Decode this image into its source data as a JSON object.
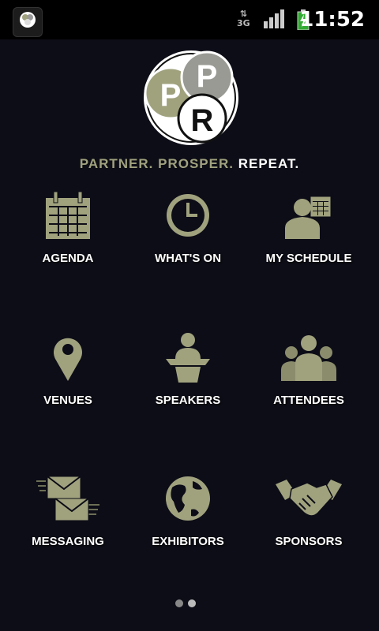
{
  "status": {
    "time": "11:52",
    "network": "3G",
    "app_icon": "ppr-app-icon",
    "icons": [
      "data-arrows-icon",
      "signal-icon",
      "battery-charging-icon"
    ]
  },
  "brand": {
    "logo_letters": [
      "P",
      "P",
      "R"
    ],
    "tagline_1": "PARTNER. PROSPER.",
    "tagline_2": "REPEAT.",
    "accent": "#a0a27e",
    "background": "#0d0d17"
  },
  "menu": [
    {
      "label": "AGENDA",
      "icon": "calendar-icon"
    },
    {
      "label": "WHAT'S ON",
      "icon": "clock-icon"
    },
    {
      "label": "MY SCHEDULE",
      "icon": "person-calendar-icon"
    },
    {
      "label": "VENUES",
      "icon": "map-pin-icon"
    },
    {
      "label": "SPEAKERS",
      "icon": "podium-speaker-icon"
    },
    {
      "label": "ATTENDEES",
      "icon": "people-group-icon"
    },
    {
      "label": "MESSAGING",
      "icon": "envelopes-icon"
    },
    {
      "label": "EXHIBITORS",
      "icon": "globe-icon"
    },
    {
      "label": "SPONSORS",
      "icon": "handshake-icon"
    }
  ],
  "pager": {
    "pages": 2,
    "current": 1
  }
}
